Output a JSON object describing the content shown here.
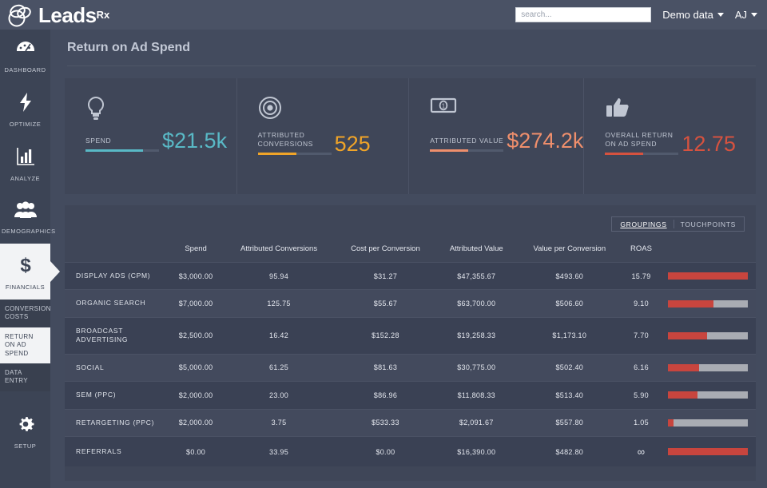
{
  "brand": {
    "name": "Leads",
    "suffix": "Rx",
    "logo_icon": "overlapping-circles-logo"
  },
  "header": {
    "search_placeholder": "search...",
    "dataset_menu": "Demo data",
    "user_menu": "AJ"
  },
  "sidebar": {
    "items": [
      {
        "label": "DASHBOARD",
        "icon": "gauge-icon",
        "active": false
      },
      {
        "label": "OPTIMIZE",
        "icon": "lightning-icon",
        "active": false
      },
      {
        "label": "ANALYZE",
        "icon": "bar-chart-icon",
        "active": false
      },
      {
        "label": "DEMOGRAPHICS",
        "icon": "people-icon",
        "active": false
      },
      {
        "label": "FINANCIALS",
        "icon": "dollar-icon",
        "active": true
      }
    ],
    "sub_items": [
      {
        "label": "CONVERSION COSTS",
        "active": false
      },
      {
        "label": "RETURN ON AD SPEND",
        "active": true
      },
      {
        "label": "DATA ENTRY",
        "active": false
      }
    ],
    "setup": {
      "label": "SETUP",
      "icon": "gear-icon"
    }
  },
  "page": {
    "title": "Return on Ad Spend"
  },
  "kpis": [
    {
      "label": "SPEND",
      "value": "$21.5k",
      "color": "#59b9c6",
      "icon": "lightbulb-icon",
      "bar_pct": 78
    },
    {
      "label": "ATTRIBUTED CONVERSIONS",
      "value": "525",
      "color": "#f0a428",
      "icon": "target-icon",
      "bar_pct": 53
    },
    {
      "label": "ATTRIBUTED VALUE",
      "value": "$274.2k",
      "color": "#ef8f6c",
      "icon": "banknote-icon",
      "bar_pct": 52
    },
    {
      "label": "OVERALL RETURN ON AD SPEND",
      "value": "12.75",
      "color": "#d6523f",
      "icon": "thumbs-up-icon",
      "bar_pct": 52
    }
  ],
  "table_toggle": {
    "options": [
      {
        "label": "GROUPINGS",
        "active": true
      },
      {
        "label": "TOUCHPOINTS",
        "active": false
      }
    ]
  },
  "table": {
    "columns": [
      "",
      "Spend",
      "Attributed Conversions",
      "Cost per Conversion",
      "Attributed Value",
      "Value per Conversion",
      "ROAS",
      ""
    ],
    "rows": [
      {
        "name": "DISPLAY ADS (CPM)",
        "spend": "$3,000.00",
        "conversions": "95.94",
        "cost_per_conversion": "$31.27",
        "attributed_value": "$47,355.67",
        "value_per_conversion": "$493.60",
        "roas": "15.79",
        "bar_pct": 100
      },
      {
        "name": "ORGANIC SEARCH",
        "spend": "$7,000.00",
        "conversions": "125.75",
        "cost_per_conversion": "$55.67",
        "attributed_value": "$63,700.00",
        "value_per_conversion": "$506.60",
        "roas": "9.10",
        "bar_pct": 57
      },
      {
        "name": "BROADCAST ADVERTISING",
        "spend": "$2,500.00",
        "conversions": "16.42",
        "cost_per_conversion": "$152.28",
        "attributed_value": "$19,258.33",
        "value_per_conversion": "$1,173.10",
        "roas": "7.70",
        "bar_pct": 49
      },
      {
        "name": "SOCIAL",
        "spend": "$5,000.00",
        "conversions": "61.25",
        "cost_per_conversion": "$81.63",
        "attributed_value": "$30,775.00",
        "value_per_conversion": "$502.40",
        "roas": "6.16",
        "bar_pct": 39
      },
      {
        "name": "SEM (PPC)",
        "spend": "$2,000.00",
        "conversions": "23.00",
        "cost_per_conversion": "$86.96",
        "attributed_value": "$11,808.33",
        "value_per_conversion": "$513.40",
        "roas": "5.90",
        "bar_pct": 37
      },
      {
        "name": "RETARGETING (PPC)",
        "spend": "$2,000.00",
        "conversions": "3.75",
        "cost_per_conversion": "$533.33",
        "attributed_value": "$2,091.67",
        "value_per_conversion": "$557.80",
        "roas": "1.05",
        "bar_pct": 7
      },
      {
        "name": "REFERRALS",
        "spend": "$0.00",
        "conversions": "33.95",
        "cost_per_conversion": "$0.00",
        "attributed_value": "$16,390.00",
        "value_per_conversion": "$482.80",
        "roas": "∞",
        "bar_pct": 100
      }
    ]
  },
  "colors": {
    "accent_red": "#c8453e",
    "panel": "#3f4658",
    "background": "#434b5e",
    "sidebar": "#3c4455"
  }
}
